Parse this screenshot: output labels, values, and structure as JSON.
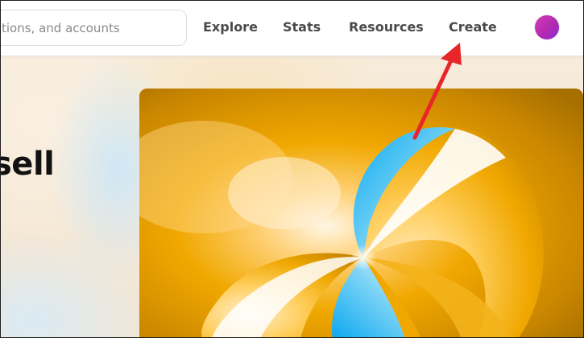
{
  "search": {
    "placeholder_visible": "tions, and accounts"
  },
  "nav": {
    "items": [
      {
        "label": "Explore"
      },
      {
        "label": "Stats"
      },
      {
        "label": "Resources"
      },
      {
        "label": "Create"
      }
    ]
  },
  "hero": {
    "title_fragment": "sell"
  },
  "colors": {
    "annotation_arrow": "#e8262a",
    "avatar": "#c233b4",
    "artwork_gold": "#f0a800",
    "artwork_blue": "#14b4ee"
  }
}
